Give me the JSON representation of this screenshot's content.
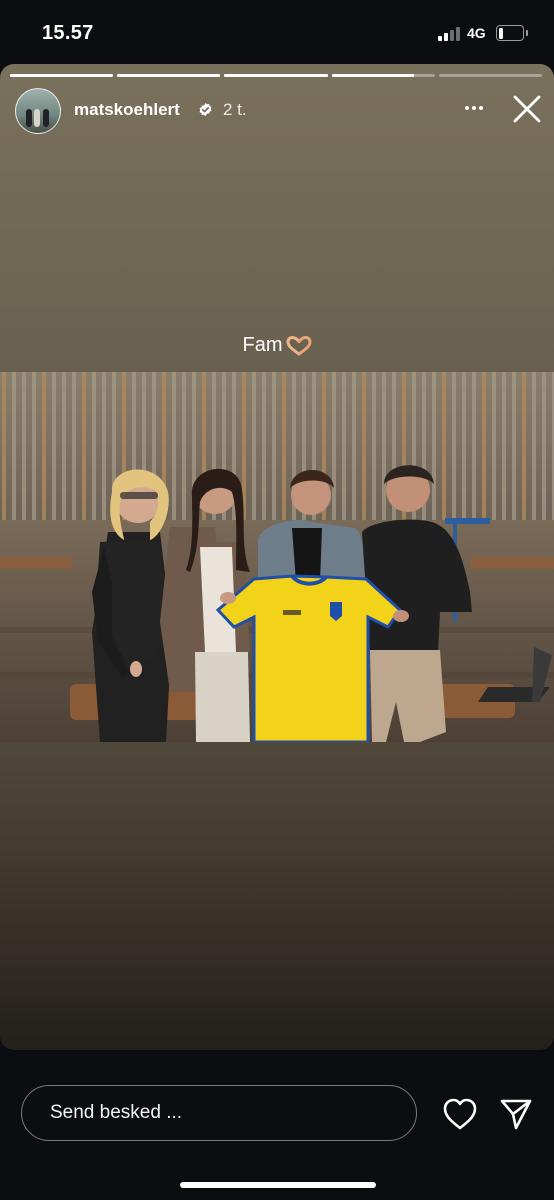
{
  "status_bar": {
    "time": "15.57",
    "network": "4G",
    "battery_level": 0.2
  },
  "story": {
    "progress": [
      1,
      1,
      1,
      0.8,
      0
    ],
    "username": "matskoehlert",
    "verified": true,
    "time_ago": "2 t.",
    "caption": "Fam",
    "caption_emoji": "heart-hands-icon"
  },
  "reply": {
    "placeholder": "Send besked ..."
  },
  "colors": {
    "jersey": "#f3d21a",
    "jersey_trim": "#1f4fa8",
    "bar_background": "#0b0d10"
  }
}
